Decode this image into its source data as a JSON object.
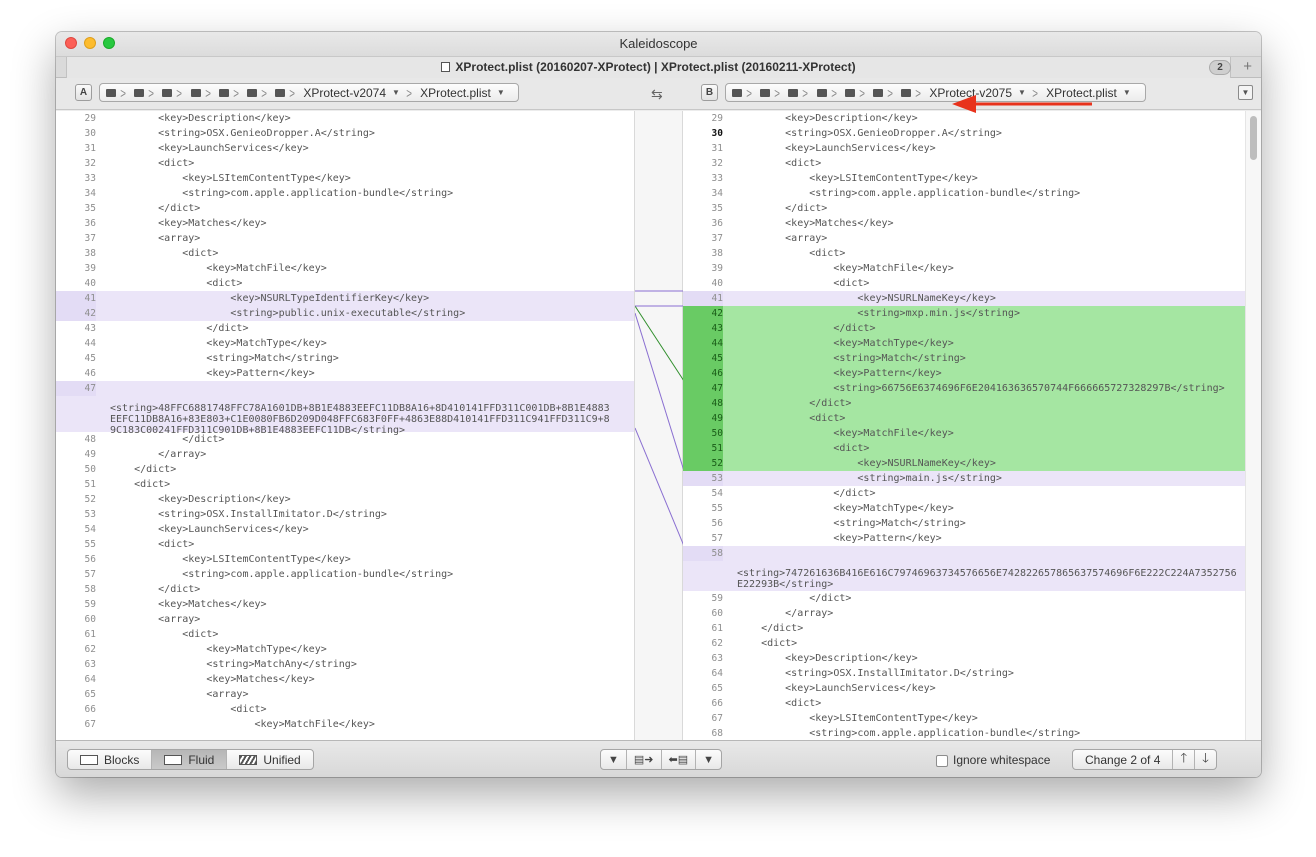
{
  "window": {
    "title": "Kaleidoscope"
  },
  "tab": {
    "title": "XProtect.plist (20160207-XProtect) | XProtect.plist (20160211-XProtect)",
    "count": "2",
    "add": "+"
  },
  "left_path": {
    "side": "A",
    "folder_label": "XProtect-v2074",
    "file_label": "XProtect.plist"
  },
  "right_path": {
    "side": "B",
    "folder_label": "XProtect-v2075",
    "file_label": "XProtect.plist"
  },
  "left_lines": [
    {
      "n": "29",
      "t": "        <key>Description</key>"
    },
    {
      "n": "30",
      "t": "        <string>OSX.GenieoDropper.A</string>"
    },
    {
      "n": "31",
      "t": "        <key>LaunchServices</key>"
    },
    {
      "n": "32",
      "t": "        <dict>"
    },
    {
      "n": "33",
      "t": "            <key>LSItemContentType</key>"
    },
    {
      "n": "34",
      "t": "            <string>com.apple.application-bundle</string>"
    },
    {
      "n": "35",
      "t": "        </dict>"
    },
    {
      "n": "36",
      "t": "        <key>Matches</key>"
    },
    {
      "n": "37",
      "t": "        <array>"
    },
    {
      "n": "38",
      "t": "            <dict>"
    },
    {
      "n": "39",
      "t": "                <key>MatchFile</key>"
    },
    {
      "n": "40",
      "t": "                <dict>"
    },
    {
      "n": "41",
      "t": "                    <key>NSURLTypeIdentifierKey</key>"
    },
    {
      "n": "42",
      "t": "                    <string>public.unix-executable</string>"
    },
    {
      "n": "43",
      "t": "                </dict>"
    },
    {
      "n": "44",
      "t": "                <key>MatchType</key>"
    },
    {
      "n": "45",
      "t": "                <string>Match</string>"
    },
    {
      "n": "46",
      "t": "                <key>Pattern</key>"
    },
    {
      "n": "47",
      "t": "<string>48FFC6881748FFC78A1601DB+8B1E4883EEFC11DB8A16+8D410141FFD311C001DB+8B1E4883EEFC11DB8A16+83E803+C1E0080FB6D209D048FFC683F0FF+4863E88D410141FFD311C941FFD311C9+89C183C00241FFD311C901DB+8B1E4883EEFC11DB</string>"
    },
    {
      "n": "48",
      "t": "            </dict>"
    },
    {
      "n": "49",
      "t": "        </array>"
    },
    {
      "n": "50",
      "t": "    </dict>"
    },
    {
      "n": "51",
      "t": "    <dict>"
    },
    {
      "n": "52",
      "t": "        <key>Description</key>"
    },
    {
      "n": "53",
      "t": "        <string>OSX.InstallImitator.D</string>"
    },
    {
      "n": "54",
      "t": "        <key>LaunchServices</key>"
    },
    {
      "n": "55",
      "t": "        <dict>"
    },
    {
      "n": "56",
      "t": "            <key>LSItemContentType</key>"
    },
    {
      "n": "57",
      "t": "            <string>com.apple.application-bundle</string>"
    },
    {
      "n": "58",
      "t": "        </dict>"
    },
    {
      "n": "59",
      "t": "        <key>Matches</key>"
    },
    {
      "n": "60",
      "t": "        <array>"
    },
    {
      "n": "61",
      "t": "            <dict>"
    },
    {
      "n": "62",
      "t": "                <key>MatchType</key>"
    },
    {
      "n": "63",
      "t": "                <string>MatchAny</string>"
    },
    {
      "n": "64",
      "t": "                <key>Matches</key>"
    },
    {
      "n": "65",
      "t": "                <array>"
    },
    {
      "n": "66",
      "t": "                    <dict>"
    },
    {
      "n": "67",
      "t": "                        <key>MatchFile</key>"
    }
  ],
  "right_lines": [
    {
      "n": "29",
      "t": "        <key>Description</key>"
    },
    {
      "n": "30",
      "t": "        <string>OSX.GenieoDropper.A</string>"
    },
    {
      "n": "31",
      "t": "        <key>LaunchServices</key>"
    },
    {
      "n": "32",
      "t": "        <dict>"
    },
    {
      "n": "33",
      "t": "            <key>LSItemContentType</key>"
    },
    {
      "n": "34",
      "t": "            <string>com.apple.application-bundle</string>"
    },
    {
      "n": "35",
      "t": "        </dict>"
    },
    {
      "n": "36",
      "t": "        <key>Matches</key>"
    },
    {
      "n": "37",
      "t": "        <array>"
    },
    {
      "n": "38",
      "t": "            <dict>"
    },
    {
      "n": "39",
      "t": "                <key>MatchFile</key>"
    },
    {
      "n": "40",
      "t": "                <dict>"
    },
    {
      "n": "41",
      "t": "                    <key>NSURLNameKey</key>"
    },
    {
      "n": "42",
      "t": "                    <string>mxp.min.js</string>"
    },
    {
      "n": "43",
      "t": "                </dict>"
    },
    {
      "n": "44",
      "t": "                <key>MatchType</key>"
    },
    {
      "n": "45",
      "t": "                <string>Match</string>"
    },
    {
      "n": "46",
      "t": "                <key>Pattern</key>"
    },
    {
      "n": "47",
      "t": "                <string>66756E6374696F6E204163636570744F666665727328297B</string>"
    },
    {
      "n": "48",
      "t": "            </dict>"
    },
    {
      "n": "49",
      "t": "            <dict>"
    },
    {
      "n": "50",
      "t": "                <key>MatchFile</key>"
    },
    {
      "n": "51",
      "t": "                <dict>"
    },
    {
      "n": "52",
      "t": "                    <key>NSURLNameKey</key>"
    },
    {
      "n": "53",
      "t": "                    <string>main.js</string>"
    },
    {
      "n": "54",
      "t": "                </dict>"
    },
    {
      "n": "55",
      "t": "                <key>MatchType</key>"
    },
    {
      "n": "56",
      "t": "                <string>Match</string>"
    },
    {
      "n": "57",
      "t": "                <key>Pattern</key>"
    },
    {
      "n": "58",
      "t": "<string>747261636B416E616C79746963734576656E742822657865637574696F6E222C224A7352756E22293B</string>"
    },
    {
      "n": "59",
      "t": "            </dict>"
    },
    {
      "n": "60",
      "t": "        </array>"
    },
    {
      "n": "61",
      "t": "    </dict>"
    },
    {
      "n": "62",
      "t": "    <dict>"
    },
    {
      "n": "63",
      "t": "        <key>Description</key>"
    },
    {
      "n": "64",
      "t": "        <string>OSX.InstallImitator.D</string>"
    },
    {
      "n": "65",
      "t": "        <key>LaunchServices</key>"
    },
    {
      "n": "66",
      "t": "        <dict>"
    },
    {
      "n": "67",
      "t": "            <key>LSItemContentType</key>"
    },
    {
      "n": "68",
      "t": "            <string>com.apple.application-bundle</string>"
    }
  ],
  "footer": {
    "modes": [
      "Blocks",
      "Fluid",
      "Unified"
    ],
    "active_mode": "Fluid",
    "ignore_whitespace_label": "Ignore whitespace",
    "ignore_whitespace_checked": false,
    "change_label": "Change 2 of 4"
  },
  "colors": {
    "added": "#a5e6a2",
    "modified": "#ebe5f8",
    "connector": "#8a6fd1",
    "annotation_arrow": "#e8321c"
  }
}
